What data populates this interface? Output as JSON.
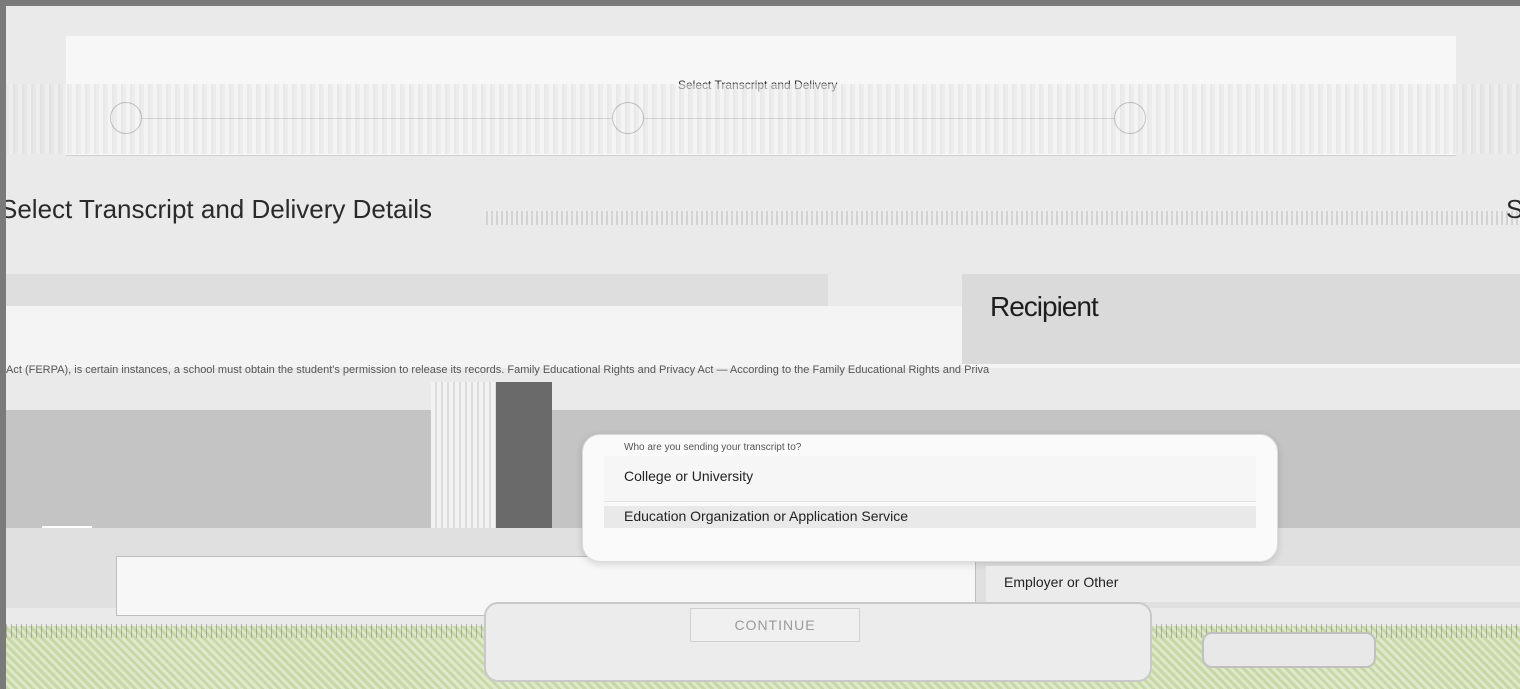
{
  "stepper": {
    "current_step_title": "Select Transcript and Delivery"
  },
  "page": {
    "heading": "Select Transcript and Delivery Details",
    "heading_right": "S"
  },
  "recipient": {
    "title": "Recipient"
  },
  "ferpa": {
    "text": "Act (FERPA), is certain instances, a school must obtain the student's permission to release its records. Family Educational Rights and Privacy Act — According to the Family Educational Rights and Priva"
  },
  "dropdown": {
    "label": "Who are you sending your transcript to?",
    "options": [
      "College or University",
      "Education Organization or Application Service",
      "Employer or Other"
    ]
  },
  "actions": {
    "continue_label": "CONTINUE"
  }
}
